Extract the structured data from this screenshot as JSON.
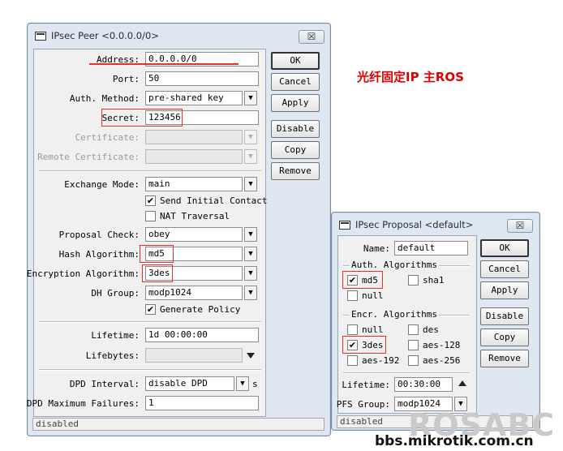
{
  "annotation": "光纤固定IP 主ROS",
  "watermark": {
    "brand": "ROSABC",
    "site": "bbs.mikrotik.com.cn"
  },
  "peer_window": {
    "title": "IPsec Peer <0.0.0.0/0>",
    "close": "☒",
    "fields": {
      "address": {
        "label": "Address:",
        "value": "0.0.0.0/0"
      },
      "port": {
        "label": "Port:",
        "value": "50"
      },
      "auth_method": {
        "label": "Auth. Method:",
        "value": "pre-shared key"
      },
      "secret": {
        "label": "Secret:",
        "value": "123456"
      },
      "certificate": {
        "label": "Certificate:",
        "value": ""
      },
      "remote_certificate": {
        "label": "Remote Certificate:",
        "value": ""
      },
      "exchange_mode": {
        "label": "Exchange Mode:",
        "value": "main"
      },
      "proposal_check": {
        "label": "Proposal Check:",
        "value": "obey"
      },
      "hash_algorithm": {
        "label": "Hash Algorithm:",
        "value": "md5"
      },
      "encryption_algorithm": {
        "label": "Encryption Algorithm:",
        "value": "3des"
      },
      "dh_group": {
        "label": "DH Group:",
        "value": "modp1024"
      },
      "lifetime": {
        "label": "Lifetime:",
        "value": "1d 00:00:00"
      },
      "lifebytes": {
        "label": "Lifebytes:",
        "value": ""
      },
      "dpd_interval": {
        "label": "DPD Interval:",
        "value": "disable DPD",
        "unit": "s"
      },
      "dpd_max_failures": {
        "label": "DPD Maximum Failures:",
        "value": "1"
      }
    },
    "checkboxes": {
      "send_initial_contact": {
        "label": "Send Initial Contact",
        "checked": true
      },
      "nat_traversal": {
        "label": "NAT Traversal",
        "checked": false
      },
      "generate_policy": {
        "label": "Generate Policy",
        "checked": true
      }
    },
    "buttons": {
      "ok": "OK",
      "cancel": "Cancel",
      "apply": "Apply",
      "disable": "Disable",
      "copy": "Copy",
      "remove": "Remove"
    },
    "status": "disabled"
  },
  "proposal_window": {
    "title": "IPsec Proposal <default>",
    "close": "☒",
    "name": {
      "label": "Name:",
      "value": "default"
    },
    "auth_group": {
      "label": "Auth. Algorithms",
      "md5": {
        "label": "md5",
        "checked": true
      },
      "sha1": {
        "label": "sha1",
        "checked": false
      },
      "null": {
        "label": "null",
        "checked": false
      }
    },
    "encr_group": {
      "label": "Encr. Algorithms",
      "null": {
        "label": "null",
        "checked": false
      },
      "des": {
        "label": "des",
        "checked": false
      },
      "3des": {
        "label": "3des",
        "checked": true
      },
      "aes128": {
        "label": "aes-128",
        "checked": false
      },
      "aes192": {
        "label": "aes-192",
        "checked": false
      },
      "aes256": {
        "label": "aes-256",
        "checked": false
      }
    },
    "lifetime": {
      "label": "Lifetime:",
      "value": "00:30:00"
    },
    "pfs_group": {
      "label": "PFS Group:",
      "value": "modp1024"
    },
    "buttons": {
      "ok": "OK",
      "cancel": "Cancel",
      "apply": "Apply",
      "disable": "Disable",
      "copy": "Copy",
      "remove": "Remove"
    },
    "status": "disabled"
  },
  "icons": {
    "dropdown": "▼",
    "check": "✔"
  },
  "colors": {
    "highlight": "#e53030",
    "annotation": "#e00000"
  }
}
